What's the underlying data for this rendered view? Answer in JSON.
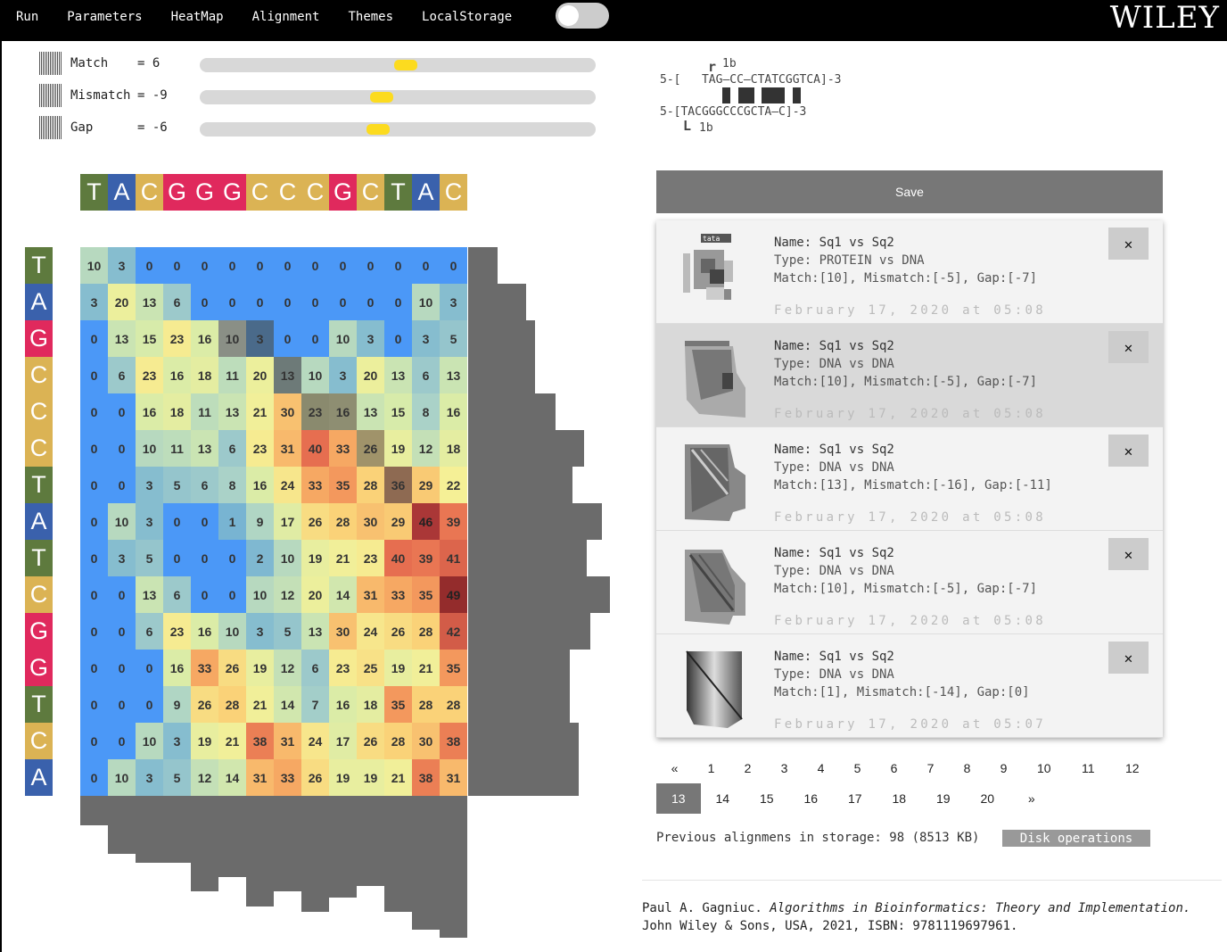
{
  "menu": [
    "Run",
    "Parameters",
    "HeatMap",
    "Alignment",
    "Themes",
    "LocalStorage"
  ],
  "logo": "WILEY",
  "parameters": [
    {
      "label": "Match",
      "value": "= 6",
      "slider_fraction": 0.52
    },
    {
      "label": "Mismatch",
      "value": "= -9",
      "slider_fraction": 0.46
    },
    {
      "label": "Gap",
      "value": "= -6",
      "slider_fraction": 0.45
    }
  ],
  "alignment": {
    "top_marker": "r",
    "top_pos": "1b",
    "line1": "5-[   TAG—CC—CTATCGGTCA]-3",
    "line2": "5-[TACGGGCCCGCTA—C]-3",
    "bottom_marker": "L",
    "bottom_pos": "1b"
  },
  "seq_top": [
    "T",
    "A",
    "C",
    "G",
    "G",
    "G",
    "C",
    "C",
    "C",
    "G",
    "C",
    "T",
    "A",
    "C"
  ],
  "seq_left": [
    "T",
    "A",
    "G",
    "C",
    "C",
    "C",
    "T",
    "A",
    "T",
    "C",
    "G",
    "G",
    "T",
    "C",
    "A"
  ],
  "matrix": [
    [
      10,
      3,
      0,
      0,
      0,
      0,
      0,
      0,
      0,
      0,
      0,
      0,
      0,
      0
    ],
    [
      3,
      20,
      13,
      6,
      0,
      0,
      0,
      0,
      0,
      0,
      0,
      0,
      10,
      3
    ],
    [
      0,
      13,
      15,
      23,
      16,
      10,
      3,
      0,
      0,
      10,
      3,
      0,
      3,
      5
    ],
    [
      0,
      6,
      23,
      16,
      18,
      11,
      20,
      13,
      10,
      3,
      20,
      13,
      6,
      13
    ],
    [
      0,
      0,
      16,
      18,
      11,
      13,
      21,
      30,
      23,
      16,
      13,
      15,
      8,
      16
    ],
    [
      0,
      0,
      10,
      11,
      13,
      6,
      23,
      31,
      40,
      33,
      26,
      19,
      12,
      18
    ],
    [
      0,
      0,
      3,
      5,
      6,
      8,
      16,
      24,
      33,
      35,
      28,
      36,
      29,
      22
    ],
    [
      0,
      10,
      3,
      0,
      0,
      1,
      9,
      17,
      26,
      28,
      30,
      29,
      46,
      39
    ],
    [
      0,
      3,
      5,
      0,
      0,
      0,
      2,
      10,
      19,
      21,
      23,
      40,
      39,
      41
    ],
    [
      0,
      0,
      13,
      6,
      0,
      0,
      10,
      12,
      20,
      14,
      31,
      33,
      35,
      49
    ],
    [
      0,
      0,
      6,
      23,
      16,
      10,
      3,
      5,
      13,
      30,
      24,
      26,
      28,
      42
    ],
    [
      0,
      0,
      0,
      16,
      33,
      26,
      19,
      12,
      6,
      23,
      25,
      19,
      21,
      35
    ],
    [
      0,
      0,
      0,
      9,
      26,
      28,
      21,
      14,
      7,
      16,
      18,
      35,
      28,
      28
    ],
    [
      0,
      0,
      10,
      3,
      19,
      21,
      38,
      31,
      24,
      17,
      26,
      28,
      30,
      38
    ],
    [
      0,
      10,
      3,
      5,
      12,
      14,
      31,
      33,
      26,
      19,
      19,
      21,
      38,
      31
    ]
  ],
  "save_label": "Save",
  "cards": [
    {
      "name": "Name: Sq1 vs Sq2",
      "type": "Type: PROTEIN vs DNA",
      "params": "Match:[10], Mismatch:[-5], Gap:[-7]",
      "date": "February 17, 2020 at 05:08",
      "thumb_text": "tata",
      "close": "✕"
    },
    {
      "name": "Name: Sq1 vs Sq2",
      "type": "Type: DNA vs DNA",
      "params": "Match:[10], Mismatch:[-5], Gap:[-7]",
      "date": "February 17, 2020 at 05:08",
      "close": "✕"
    },
    {
      "name": "Name: Sq1 vs Sq2",
      "type": "Type: DNA vs DNA",
      "params": "Match:[13], Mismatch:[-16], Gap:[-11]",
      "date": "February 17, 2020 at 05:08",
      "close": "✕"
    },
    {
      "name": "Name: Sq1 vs Sq2",
      "type": "Type: DNA vs DNA",
      "params": "Match:[10], Mismatch:[-5], Gap:[-7]",
      "date": "February 17, 2020 at 05:08",
      "close": "✕"
    },
    {
      "name": "Name: Sq1 vs Sq2",
      "type": "Type: DNA vs DNA",
      "params": "Match:[1], Mismatch:[-14], Gap:[0]",
      "date": "February 17, 2020 at 05:07",
      "close": "✕"
    }
  ],
  "pager_row1": [
    "«",
    "1",
    "2",
    "3",
    "4",
    "5",
    "6",
    "7",
    "8",
    "9",
    "10",
    "11",
    "12"
  ],
  "pager_row2": [
    "13",
    "14",
    "15",
    "16",
    "17",
    "18",
    "19",
    "20",
    "»"
  ],
  "pager_current": "13",
  "storage_text": "Previous alignmens in storage: 98 (8513 KB)",
  "disk_button": "Disk operations",
  "citation": {
    "author": "Paul A. Gagniuc. ",
    "title": "Algorithms in Bioinformatics: Theory and Implementation.",
    "line2": "John Wiley & Sons, USA, 2021, ISBN: 9781119697961."
  }
}
